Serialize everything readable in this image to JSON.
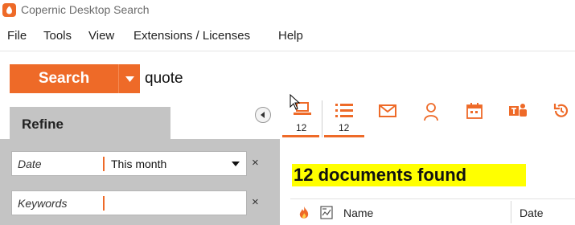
{
  "window": {
    "title": "Copernic Desktop Search"
  },
  "menu": [
    {
      "label": "File"
    },
    {
      "label": "Tools"
    },
    {
      "label": "View"
    },
    {
      "label": "Extensions / Licenses"
    },
    {
      "label": "Help"
    }
  ],
  "search": {
    "button_label": "Search",
    "query": "quote",
    "dropdown_icon": "caret-down-icon"
  },
  "refine": {
    "title": "Refine",
    "fields": [
      {
        "label": "Date",
        "value": "This month",
        "has_dropdown": true
      },
      {
        "label": "Keywords",
        "value": "",
        "has_dropdown": false
      }
    ],
    "clear_symbol": "×"
  },
  "categories": [
    {
      "icon": "computer-icon",
      "count": "12",
      "selected": true
    },
    {
      "icon": "list-icon",
      "count": "12",
      "selected": true
    },
    {
      "icon": "mail-icon",
      "count": ""
    },
    {
      "icon": "contact-icon",
      "count": ""
    },
    {
      "icon": "calendar-icon",
      "count": ""
    },
    {
      "icon": "teams-icon",
      "count": ""
    },
    {
      "icon": "history-icon",
      "count": ""
    }
  ],
  "results": {
    "summary": "12 documents found",
    "columns": [
      {
        "label": "Name"
      },
      {
        "label": "Date"
      }
    ]
  },
  "colors": {
    "accent": "#ee6a28",
    "highlight": "#ffff00",
    "panel": "#c4c4c4"
  }
}
